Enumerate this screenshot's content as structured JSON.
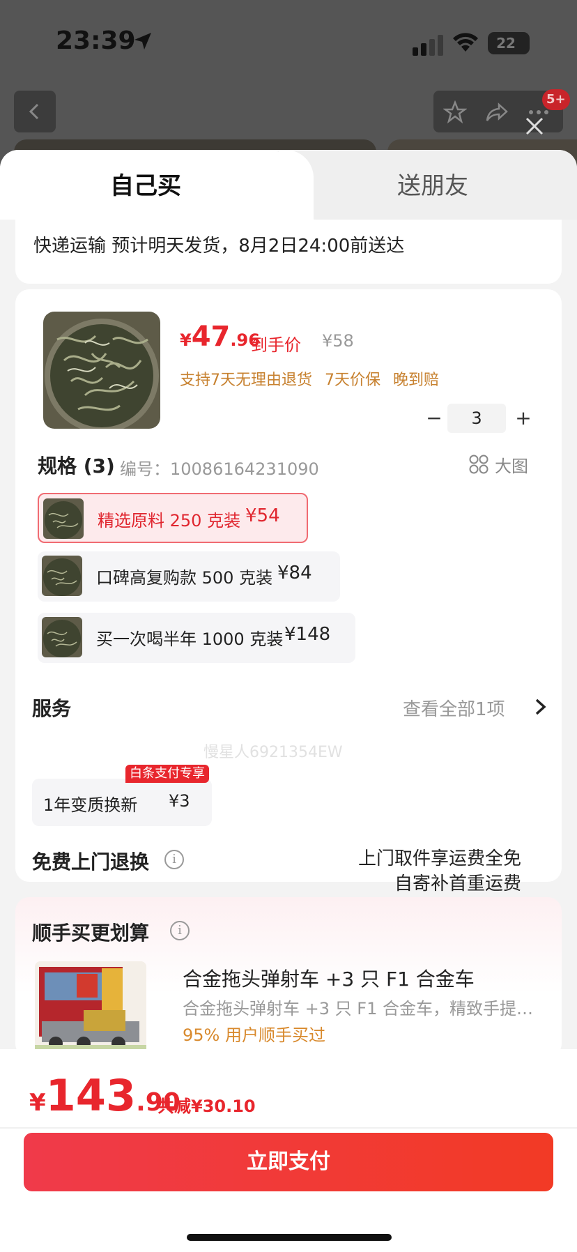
{
  "status_bar": {
    "time": "23:39",
    "battery": "22"
  },
  "nav": {
    "badge": "5+"
  },
  "tabs": {
    "self": "自己买",
    "friend": "送朋友"
  },
  "delivery": {
    "text": "快递运输 预计明天发货，8月2日24:00前送达"
  },
  "product": {
    "currency": "¥",
    "price_int": "47",
    "price_dec": ".96",
    "price_label": "到手价",
    "original_price": "¥58",
    "guarantees": [
      "支持7天无理由退货",
      "7天价保",
      "晚到赔"
    ],
    "quantity": "3",
    "minus": "−",
    "plus": "+"
  },
  "spec": {
    "title": "规格 (3)",
    "code": "编号：10086164231090",
    "bigpic_label": "大图",
    "options": [
      {
        "name": "精选原料 250 克装",
        "price": "¥54",
        "selected": true
      },
      {
        "name": "口碑高复购款 500 克装",
        "price": "¥84",
        "selected": false
      },
      {
        "name": "买一次喝半年 1000 克装",
        "price": "¥148",
        "selected": false
      }
    ]
  },
  "watermark": "慢星人6921354EW",
  "service": {
    "title": "服务",
    "view_all": "查看全部1项",
    "chip_name": "1年变质换新",
    "chip_price": "¥3",
    "chip_tag": "白条支付专享"
  },
  "return": {
    "title": "免费上门退换",
    "info": "i",
    "line1": "上门取件享运费全免",
    "line2": "自寄补首重运费"
  },
  "addon": {
    "title": "顺手买更划算",
    "info": "i",
    "name": "合金拖头弹射车 +3 只 F1 合金车",
    "desc": "合金拖头弹射车 +3 只 F1 合金车，精致手提…",
    "stat": "95% 用户顺手买过"
  },
  "footer": {
    "currency": "¥",
    "total_int": "143",
    "total_dec": ".90",
    "discount": "共减¥30.10",
    "pay_label": "立即支付"
  },
  "colors": {
    "accent": "#e8262d",
    "guarantee": "#c7812f",
    "selected_bg": "#fdeaec"
  },
  "icons": [
    "location-arrow-icon",
    "signal-icon",
    "wifi-icon",
    "battery-icon",
    "back-icon",
    "star-icon",
    "share-icon",
    "more-icon",
    "close-icon",
    "grid-icon",
    "chevron-right-icon",
    "info-icon"
  ]
}
